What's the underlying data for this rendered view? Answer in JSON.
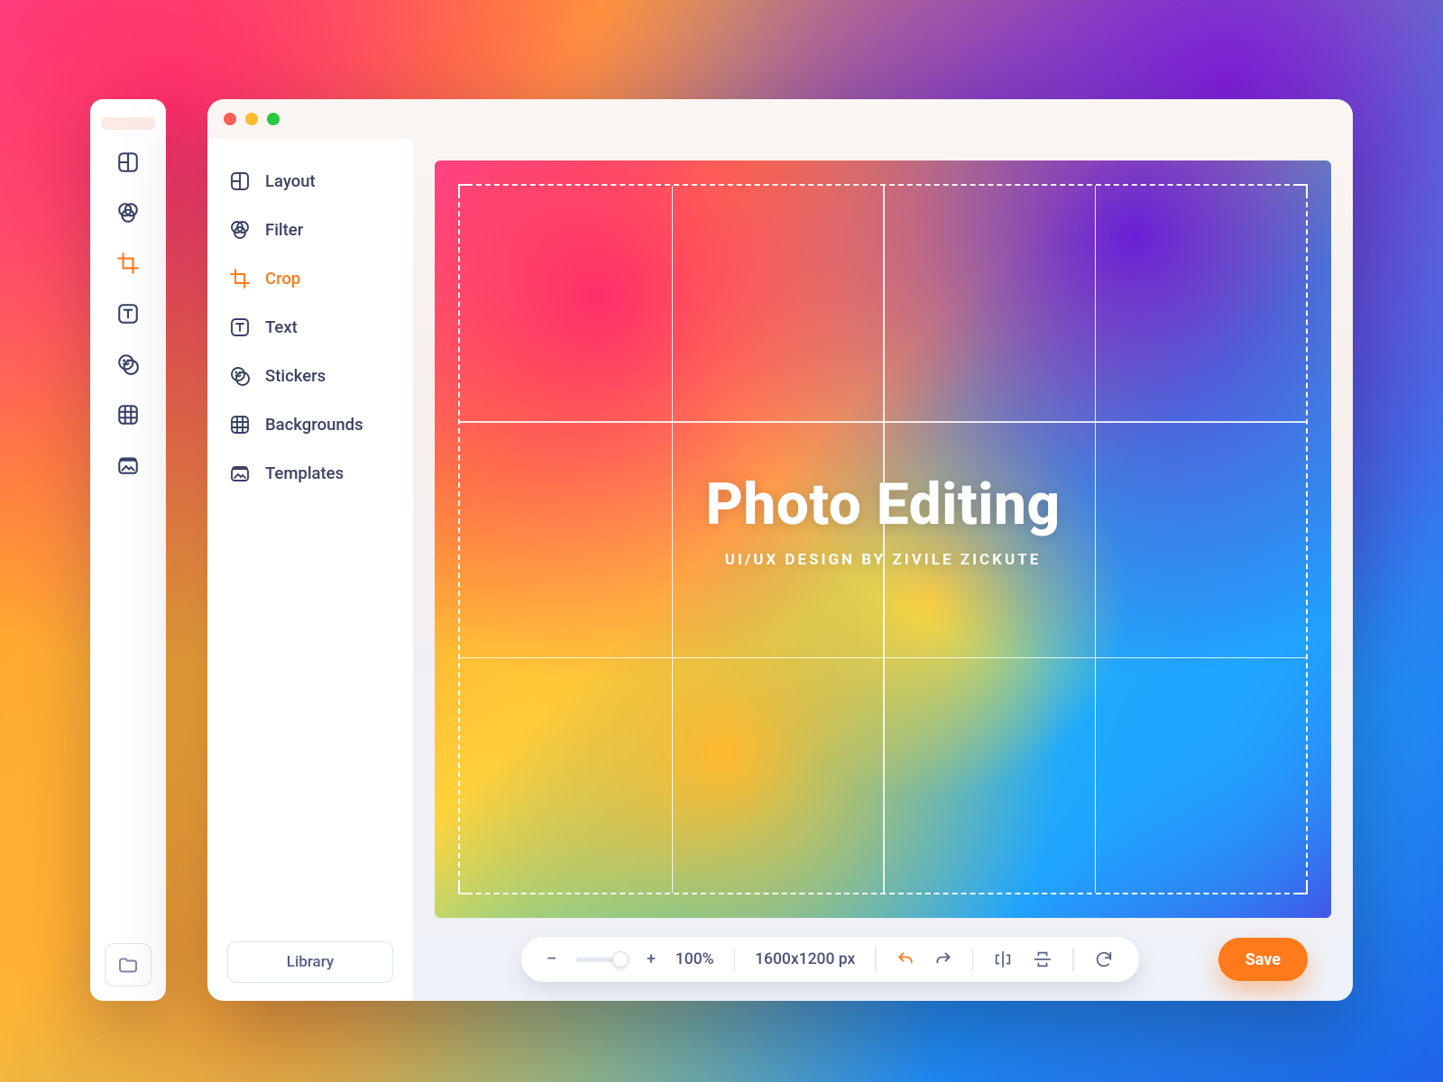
{
  "mini_toolbar": {
    "tools": [
      "layout",
      "filter",
      "crop",
      "text",
      "stickers",
      "backgrounds",
      "templates"
    ],
    "active_index": 2
  },
  "sidebar": {
    "items": [
      {
        "icon": "layout",
        "label": "Layout"
      },
      {
        "icon": "filter",
        "label": "Filter"
      },
      {
        "icon": "crop",
        "label": "Crop"
      },
      {
        "icon": "text",
        "label": "Text"
      },
      {
        "icon": "stickers",
        "label": "Stickers"
      },
      {
        "icon": "backgrounds",
        "label": "Backgrounds"
      },
      {
        "icon": "templates",
        "label": "Templates"
      }
    ],
    "active_index": 2,
    "library_label": "Library"
  },
  "canvas": {
    "title": "Photo Editing",
    "subtitle": "UI/UX DESIGN BY ZIVILE ZICKUTE"
  },
  "bottombar": {
    "zoom_minus": "–",
    "zoom_plus": "+",
    "zoom_value": "100%",
    "dimensions": "1600x1200 px",
    "save_label": "Save"
  },
  "colors": {
    "accent": "#ff7a1a",
    "text": "#3b4263"
  }
}
